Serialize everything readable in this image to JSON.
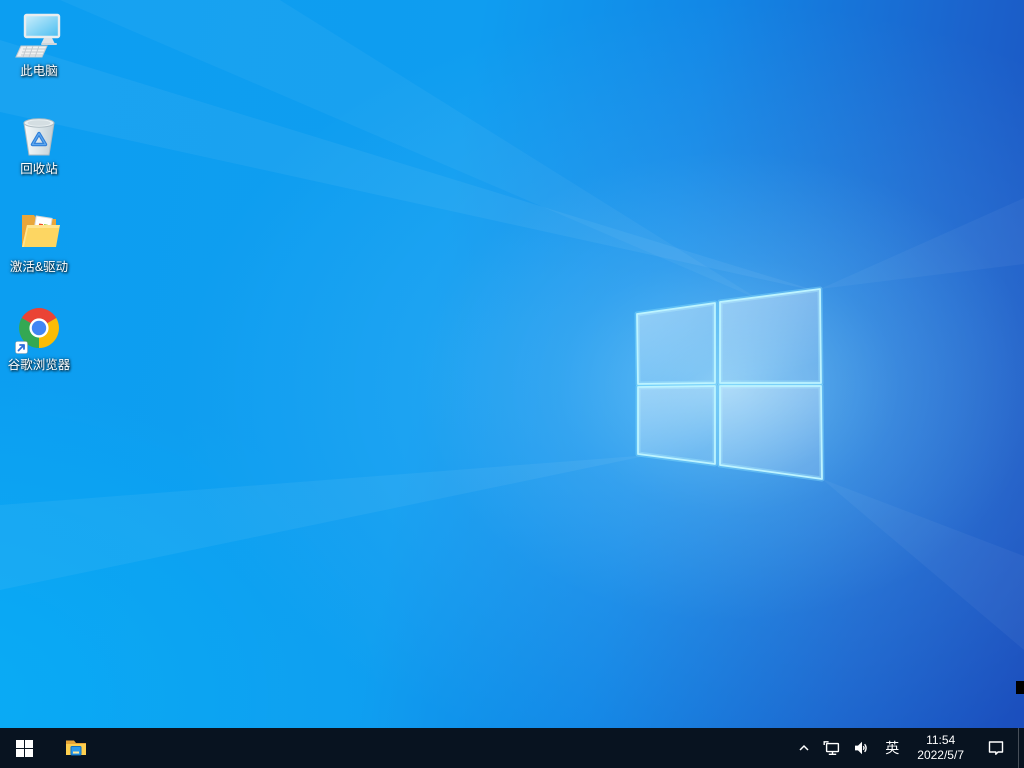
{
  "desktop": {
    "icons": [
      {
        "label": "此电脑",
        "icon": "monitor-keyboard-icon"
      },
      {
        "label": "回收站",
        "icon": "recycle-bin-icon"
      },
      {
        "label": "激活&驱动",
        "icon": "open-folder-windows-icon"
      },
      {
        "label": "谷歌浏览器",
        "icon": "chrome-logo-icon"
      }
    ],
    "wallpaper": {
      "style": "windows10-light-logo",
      "left_color": "#0aa2f2",
      "right_color": "#1a4fbe",
      "logo_edge_color": "#bdf4ff"
    }
  },
  "taskbar": {
    "background_color": "#081320",
    "buttons": [
      {
        "icon": "start-icon"
      },
      {
        "icon": "file-explorer-icon"
      }
    ],
    "tray": {
      "hidden_icons_chevron_icon": "chevron-up-icon",
      "network_icon": "network-ethernet-icon",
      "volume_icon": "volume-icon",
      "language": "英",
      "clock": {
        "time": "11:54",
        "date": "2022/5/7"
      },
      "action_center_icon": "action-center-icon"
    }
  }
}
